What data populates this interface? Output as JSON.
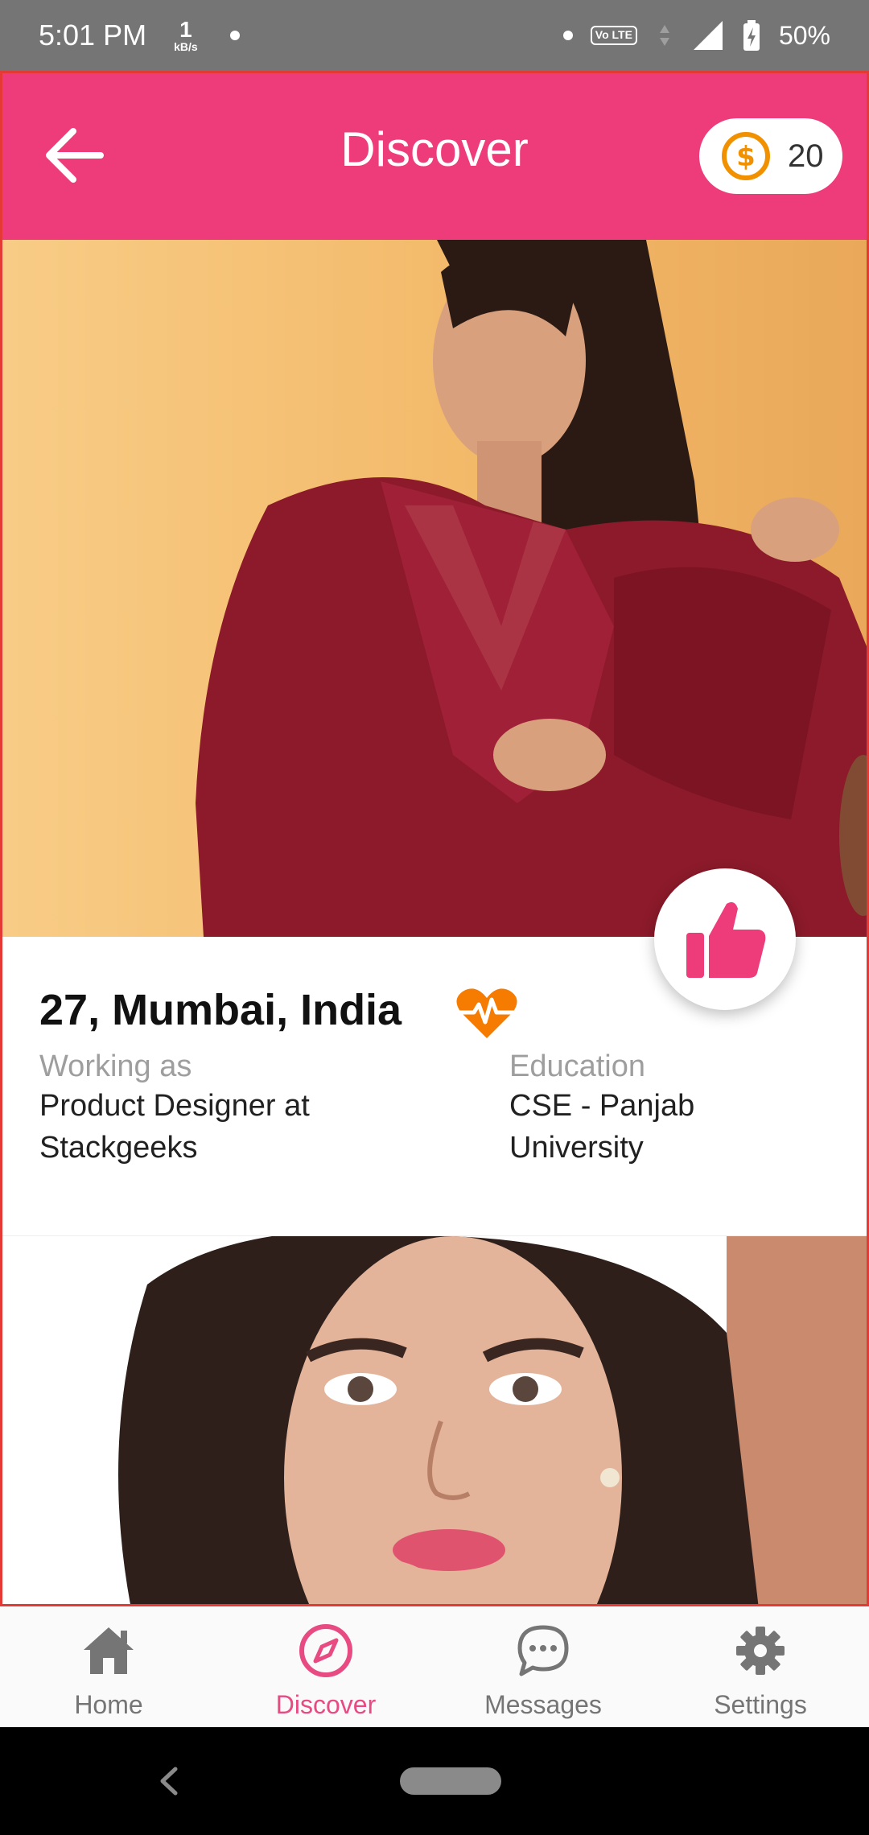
{
  "status_bar": {
    "time": "5:01 PM",
    "speed_value": "1",
    "speed_unit": "kB/s",
    "network_badge": "Vo LTE",
    "battery": "50%"
  },
  "header": {
    "title": "Discover",
    "coins": "20"
  },
  "profile": {
    "heading": "27, Mumbai, India",
    "work_label": "Working as",
    "work_value": "Product Designer at Stackgeeks",
    "education_label": "Education",
    "education_value": "CSE - Panjab University"
  },
  "bottom_nav": {
    "items": [
      {
        "label": "Home",
        "icon": "home-icon"
      },
      {
        "label": "Discover",
        "icon": "compass-icon"
      },
      {
        "label": "Messages",
        "icon": "chat-bubble-icon"
      },
      {
        "label": "Settings",
        "icon": "gear-icon"
      }
    ],
    "active": "Discover"
  },
  "colors": {
    "brand_pink": "#ee3b7a",
    "coin_orange": "#f29100",
    "heart_orange": "#f57c00",
    "active_nav": "#e84a82"
  }
}
